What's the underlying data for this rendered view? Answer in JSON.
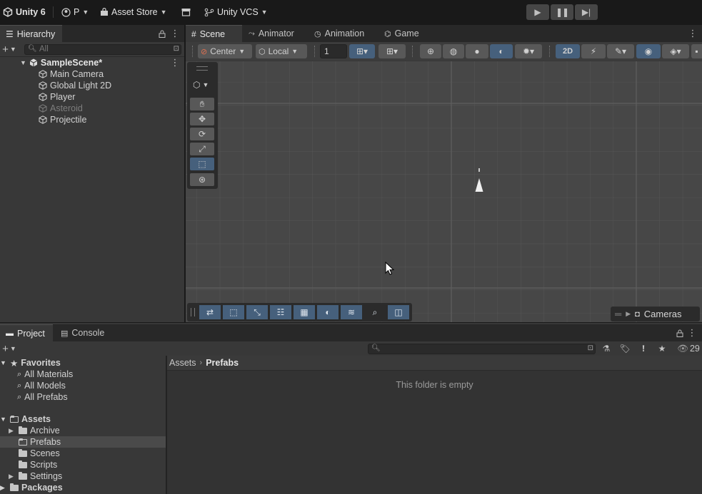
{
  "topbar": {
    "app_title": "Unity 6",
    "account": "P",
    "asset_store": "Asset Store",
    "vcs": "Unity VCS"
  },
  "hierarchy": {
    "tab_label": "Hierarchy",
    "search_placeholder": "All",
    "scene_name": "SampleScene*",
    "items": [
      {
        "label": "Main Camera",
        "disabled": false
      },
      {
        "label": "Global Light 2D",
        "disabled": false
      },
      {
        "label": "Player",
        "disabled": false
      },
      {
        "label": "Asteroid",
        "disabled": true
      },
      {
        "label": "Projectile",
        "disabled": false
      }
    ]
  },
  "scene_view": {
    "tabs": [
      {
        "label": "Scene",
        "icon": "grid-icon",
        "active": true
      },
      {
        "label": "Animator",
        "icon": "animator-icon",
        "active": false
      },
      {
        "label": "Animation",
        "icon": "clock-icon",
        "active": false
      },
      {
        "label": "Game",
        "icon": "gamepad-icon",
        "active": false
      }
    ],
    "pivot_mode": "Center",
    "pivot_space": "Local",
    "grid_snap_value": "1",
    "mode_2d_label": "2D",
    "overlay_label": "Cameras"
  },
  "project": {
    "tabs": [
      {
        "label": "Project",
        "active": true
      },
      {
        "label": "Console",
        "active": false
      }
    ],
    "visible_count": "29",
    "favorites_label": "Favorites",
    "favorites": [
      "All Materials",
      "All Models",
      "All Prefabs"
    ],
    "assets_label": "Assets",
    "asset_folders": [
      {
        "label": "Archive",
        "expandable": true,
        "selected": false
      },
      {
        "label": "Prefabs",
        "expandable": false,
        "selected": true
      },
      {
        "label": "Scenes",
        "expandable": false,
        "selected": false
      },
      {
        "label": "Scripts",
        "expandable": false,
        "selected": false
      },
      {
        "label": "Settings",
        "expandable": true,
        "selected": false
      }
    ],
    "packages_label": "Packages",
    "breadcrumb": [
      "Assets",
      "Prefabs"
    ],
    "empty_message": "This folder is empty"
  },
  "colors": {
    "accent_blue": "#46607c",
    "panel_bg": "#383838",
    "scene_bg": "#474747"
  }
}
